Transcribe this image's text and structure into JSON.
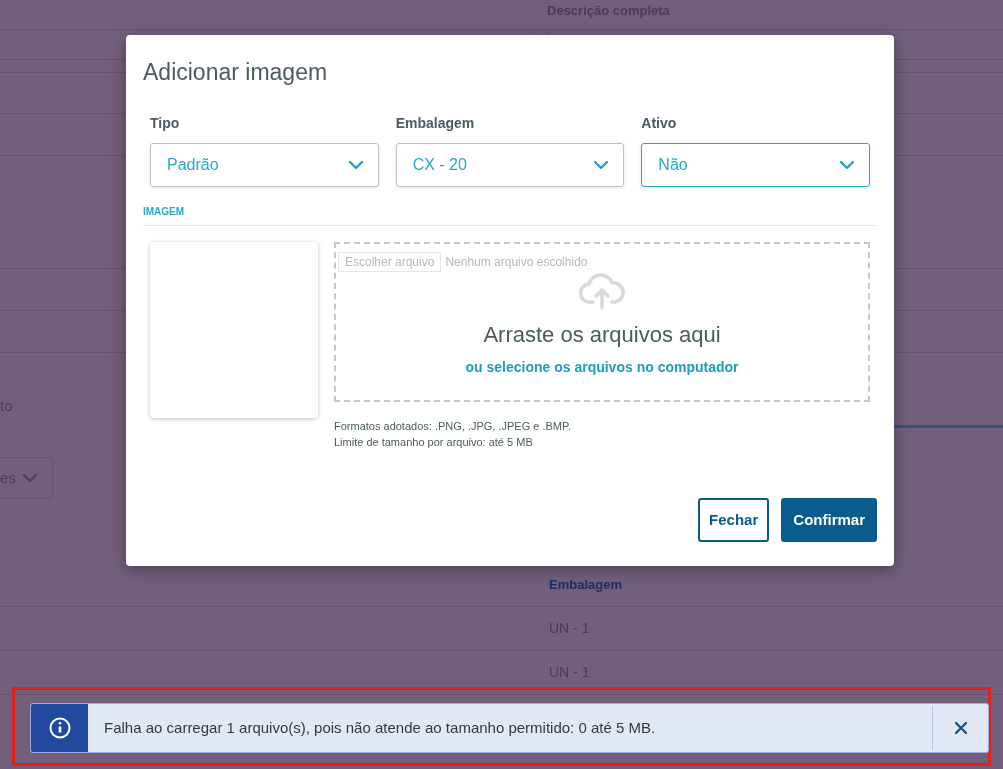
{
  "background": {
    "description_label": "Descrição completa",
    "partial_label": "to",
    "partial_select": "es",
    "table": {
      "column": "Embalagem",
      "rows": [
        "UN - 1",
        "UN - 1"
      ]
    }
  },
  "dialog": {
    "title": "Adicionar imagem",
    "selects": [
      {
        "label": "Tipo",
        "value": "Padrão",
        "focused": false
      },
      {
        "label": "Embalagem",
        "value": "CX - 20",
        "focused": false
      },
      {
        "label": "Ativo",
        "value": "Não",
        "focused": true
      }
    ],
    "section": "IMAGEM",
    "file_input": {
      "button": "Escolher arquivo",
      "status": "Nenhum arquivo escolhido"
    },
    "drop_title": "Arraste os arquivos aqui",
    "drop_link": "ou selecione os arquivos no computador",
    "notes": [
      "Formatos adotados: .PNG, .JPG, .JPEG e .BMP.",
      "Limite de tamanho por arquivo: até 5 MB"
    ],
    "buttons": [
      {
        "label": "Fechar",
        "kind": "secondary"
      },
      {
        "label": "Confirmar",
        "kind": "primary"
      }
    ]
  },
  "toast": {
    "message": "Falha ao carregar 1 arquivo(s), pois não atende ao tamanho permitido: 0 até 5 MB.",
    "highlighted": true
  }
}
